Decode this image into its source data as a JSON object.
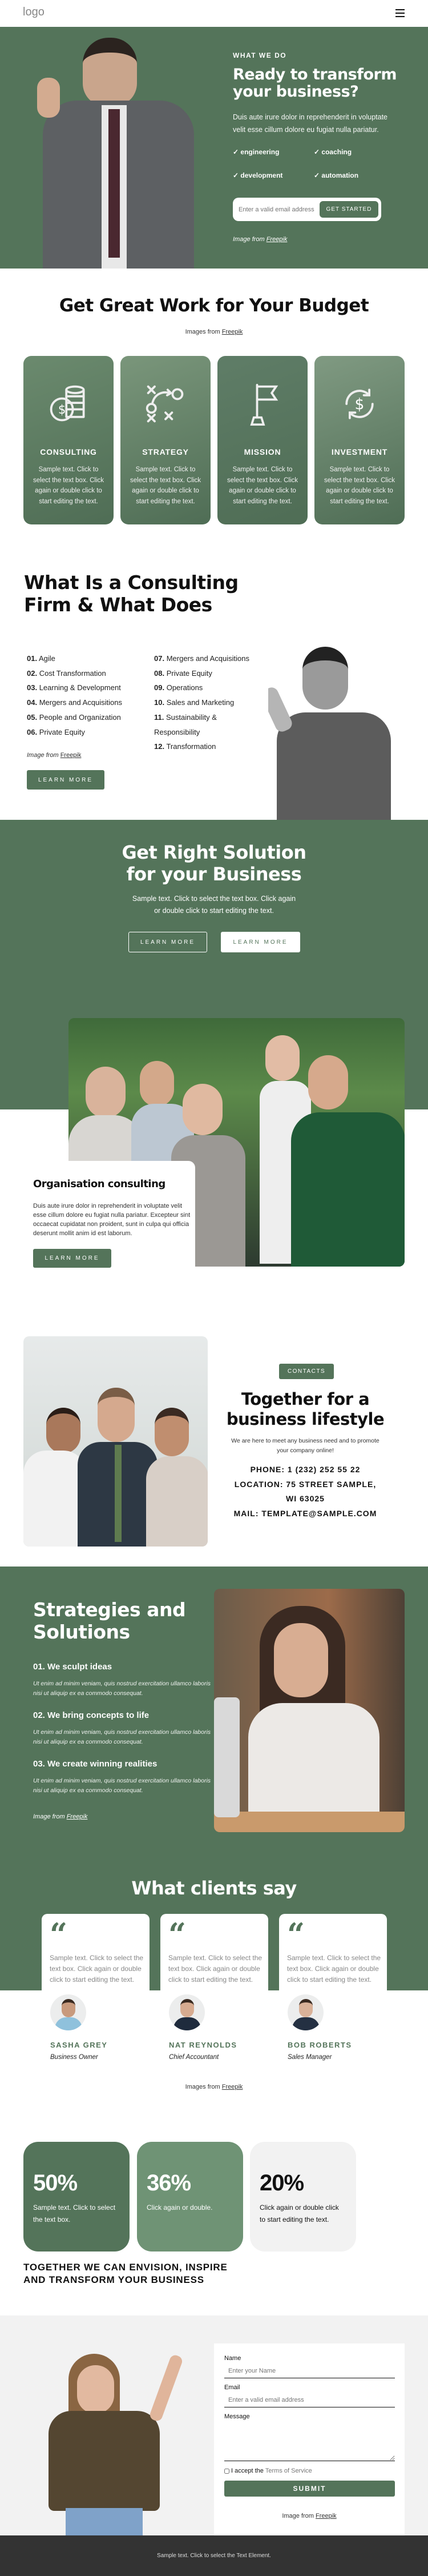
{
  "header": {
    "logo": "logo",
    "menu_icon": "hamburger-icon"
  },
  "hero": {
    "eyebrow": "WHAT WE DO",
    "title_l1": "Ready to transform",
    "title_l2": "your business?",
    "desc_l1": "Duis aute irure dolor in reprehenderit in voluptate",
    "desc_l2": "velit esse cillum dolore eu fugiat nulla pariatur.",
    "checks": [
      "engineering",
      "coaching",
      "development",
      "automation"
    ],
    "email_placeholder": "Enter a valid email address",
    "cta": "GET STARTED",
    "credit_prefix": "Image from ",
    "credit_link": "Freepik"
  },
  "budget": {
    "title": "Get Great Work for Your Budget",
    "credit_prefix": "Images from ",
    "credit_link": "Freepik",
    "cards": [
      {
        "label": "CONSULTING",
        "icon": "coins-dollar-icon",
        "text": "Sample text. Click to select the text box. Click again or double click to start editing the text."
      },
      {
        "label": "STRATEGY",
        "icon": "strategy-play-icon",
        "text": "Sample text. Click to select the text box. Click again or double click to start editing the text."
      },
      {
        "label": "MISSION",
        "icon": "flag-icon",
        "text": "Sample text. Click to select the text box. Click again or double click to start editing the text."
      },
      {
        "label": "INVESTMENT",
        "icon": "dollar-cycle-icon",
        "text": "Sample text. Click to select the text box. Click again or double click to start editing the text."
      }
    ]
  },
  "firm": {
    "title_l1": "What Is a Consulting",
    "title_l2": "Firm & What Does",
    "col1": [
      [
        "01.",
        "Agile"
      ],
      [
        "02.",
        "Cost Transformation"
      ],
      [
        "03.",
        "Learning & Development"
      ],
      [
        "04.",
        "Mergers and Acquisitions"
      ],
      [
        "05.",
        "People and Organization"
      ],
      [
        "06.",
        "Private Equity"
      ]
    ],
    "col2": [
      [
        "07.",
        "Mergers and Acquisitions"
      ],
      [
        "08.",
        "Private Equity"
      ],
      [
        "09.",
        "Operations"
      ],
      [
        "10.",
        "Sales and Marketing"
      ],
      [
        "11.",
        "Sustainability &"
      ],
      [
        "",
        "Responsibility"
      ],
      [
        "12.",
        "Transformation"
      ]
    ],
    "credit_prefix": "Image from ",
    "credit_link": "Freepik",
    "button": "LEARN MORE"
  },
  "solution": {
    "title_l1": "Get Right Solution",
    "title_l2": "for your Business",
    "desc_l1": "Sample text. Click to select the text box. Click again",
    "desc_l2": "or double click to start editing the text.",
    "button1": "LEARN MORE",
    "button2": "LEARN MORE"
  },
  "org": {
    "title": "Organisation consulting",
    "desc": [
      "Duis aute irure dolor in reprehenderit in voluptate velit",
      "esse cillum dolore eu fugiat nulla pariatur. Excepteur sint",
      "occaecat cupidatat non proident, sunt in culpa qui officia",
      "deserunt mollit anim id est laborum."
    ],
    "button": "LEARN MORE"
  },
  "contacts": {
    "badge": "CONTACTS",
    "title_l1": "Together for a",
    "title_l2": "business lifestyle",
    "desc_l1": "We are here to meet any business need and to promote",
    "desc_l2": "your company online!",
    "phone": "PHONE: 1 (232) 252 55 22",
    "location_l1": "LOCATION: 75 STREET SAMPLE,",
    "location_l2": "WI 63025",
    "mail": "MAIL: TEMPLATE@SAMPLE.COM"
  },
  "strategies": {
    "title_l1": "Strategies and",
    "title_l2": "Solutions",
    "items": [
      {
        "title": "01. We sculpt ideas",
        "l1": "Ut enim ad minim veniam, quis nostrud exercitation ullamco laboris",
        "l2": "nisi ut aliquip ex ea commodo consequat."
      },
      {
        "title": "02. We bring concepts to life",
        "l1": "Ut enim ad minim veniam, quis nostrud exercitation ullamco laboris",
        "l2": "nisi ut aliquip ex ea commodo consequat."
      },
      {
        "title": "03. We create winning realities",
        "l1": "Ut enim ad minim veniam, quis nostrud exercitation ullamco laboris",
        "l2": "nisi ut aliquip ex ea commodo consequat."
      }
    ],
    "credit_prefix": "Image from ",
    "credit_link": "Freepik"
  },
  "clients": {
    "title": "What clients say",
    "quote_glyph": "“",
    "items": [
      {
        "text": "Sample text. Click to select the text box. Click again or double click to start editing the text.",
        "name": "SASHA GREY",
        "role": "Business Owner"
      },
      {
        "text": "Sample text. Click to select the text box. Click again or double click to start editing the text.",
        "name": "NAT REYNOLDS",
        "role": "Chief Accountant"
      },
      {
        "text": "Sample text. Click to select the text box. Click again or double click to start editing the text.",
        "name": "BOB ROBERTS",
        "role": "Sales Manager"
      }
    ],
    "credit_prefix": "Images from ",
    "credit_link": "Freepik"
  },
  "stats": {
    "items": [
      {
        "value": "50%",
        "text": "Sample text. Click to select the text box.",
        "bg": "#54745a",
        "fg": "#ffffff"
      },
      {
        "value": "36%",
        "text": "Click again or double.",
        "bg": "#6f9375",
        "fg": "#ffffff"
      },
      {
        "value": "20%",
        "text": "Click again or double click to start editing the text.",
        "bg": "#f2f2f2",
        "fg": "#111111"
      }
    ],
    "tagline_l1": "TOGETHER WE CAN ENVISION, INSPIRE",
    "tagline_l2": "AND TRANSFORM YOUR BUSINESS"
  },
  "form": {
    "name_label": "Name",
    "name_placeholder": "Enter your Name",
    "email_label": "Email",
    "email_placeholder": "Enter a valid email address",
    "message_label": "Message",
    "accept_prefix": "I accept the ",
    "terms": "Terms of Service",
    "submit": "SUBMIT",
    "credit_prefix": "Image from ",
    "credit_link": "Freepik"
  },
  "footer": {
    "text": "Sample text. Click to select the Text Element."
  },
  "colors": {
    "accent": "#54745a",
    "accent_light": "#6f9375",
    "grey": "#f2f2f2",
    "footer": "#333333"
  }
}
